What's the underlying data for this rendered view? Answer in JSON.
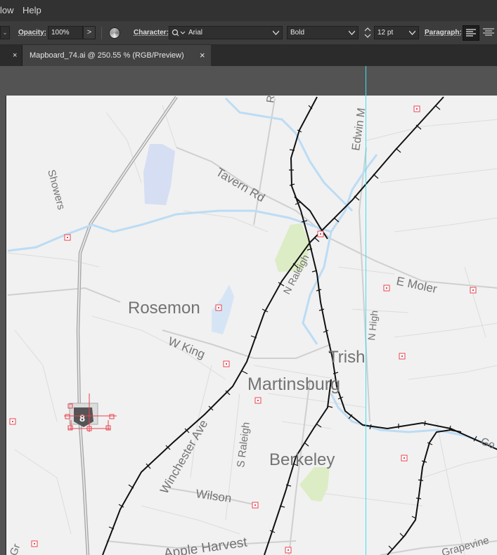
{
  "menubar": {
    "items": [
      "low",
      "Help"
    ]
  },
  "control_bar": {
    "opacity_label": "Opacity:",
    "opacity_value": "100%",
    "opacity_arrow": ">",
    "character_label": "Character:",
    "font_family": "Arial",
    "font_style": "Bold",
    "font_size": "12 pt",
    "paragraph_label": "Paragraph:"
  },
  "tabs": [
    {
      "label": "Mapboard_74.ai @ 250.55 % (RGB/Preview)",
      "close": "×"
    }
  ],
  "map": {
    "towns": [
      "Rosemon",
      "Martinsburg",
      "Trish",
      "Berkeley"
    ],
    "roads": [
      "Tavern Rd",
      "E Moler",
      "N Raleigh",
      "N High",
      "W King",
      "Winchester Ave",
      "S Raleigh",
      "Wilson",
      "Apple Harvest",
      "Edwin M",
      "Showers",
      "Grapevine",
      "Go",
      "R",
      "Gr"
    ]
  },
  "colors": {
    "menubar_bg": "#323232",
    "ctrlbar_bg": "#3c3c3c",
    "tabbar_bg": "#2b2b2b",
    "workspace_bg": "#535353",
    "artboard_bg": "#f1f1f1",
    "water": "#bcdcf4",
    "park": "#d9ecc0",
    "railroad": "#111111",
    "label_text": "#6f6f6f",
    "marker": "#e8434f",
    "guide": "#3de3ee"
  }
}
